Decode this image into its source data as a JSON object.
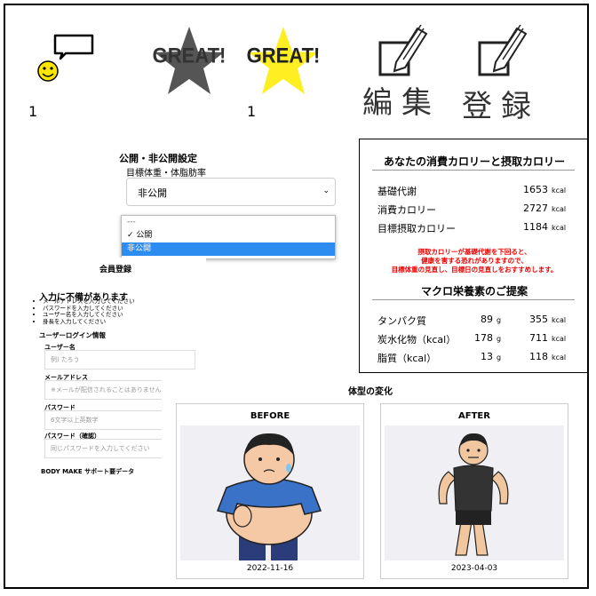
{
  "top": {
    "comment_count": "1",
    "great_label_gray": "GREAT!",
    "great_label_yellow": "GREAT!",
    "great_count": "1",
    "edit_label": "編集",
    "register_label": "登録"
  },
  "settings": {
    "title": "公開・非公開設定",
    "target_label": "目標体重・体脂肪率",
    "selected": "非公開",
    "options": [
      "---",
      "✓ 公開",
      "非公開"
    ]
  },
  "calorie": {
    "title": "あなたの消費カロリーと摂取カロリー",
    "rows": [
      {
        "label": "基礎代謝",
        "value": "1653",
        "unit": "kcal"
      },
      {
        "label": "消費カロリー",
        "value": "2727",
        "unit": "kcal"
      },
      {
        "label": "目標摂取カロリー",
        "value": "1184",
        "unit": "kcal"
      }
    ],
    "warning": [
      "摂取カロリーが基礎代謝を下回ると、",
      "健康を害する恐れがありますので、",
      "目標体重の見直し、目標日の見直しをおすすめします。"
    ],
    "macro_title": "マクロ栄養素のご提案",
    "macros": [
      {
        "label": "タンパク質",
        "grams": "89",
        "g_unit": "g",
        "kcal": "355",
        "unit": "kcal"
      },
      {
        "label": "炭水化物（kcal）",
        "grams": "178",
        "g_unit": "g",
        "kcal": "711",
        "unit": "kcal"
      },
      {
        "label": "脂質（kcal）",
        "grams": "13",
        "g_unit": "g",
        "kcal": "118",
        "unit": "kcal"
      }
    ]
  },
  "register": {
    "title": "会員登録",
    "error_title": "入力に不備があります",
    "errors": [
      "メールアドレスを入力してください",
      "パスワードを入力してください",
      "ユーザー名を入力してください",
      "身長を入力してください"
    ],
    "login_heading": "ユーザーログイン情報",
    "username_label": "ユーザー名",
    "username_placeholder": "例) たろう",
    "email_label": "メールアドレス",
    "email_placeholder": "※メールが配信されることはありません",
    "password_label": "パスワード",
    "password_placeholder": "6文字以上英数字",
    "password_confirm_label": "パスワード（確認）",
    "password_confirm_placeholder": "同じパスワードを入力してください",
    "footer_partial": "BODY MAKE サポート要データ"
  },
  "body_change": {
    "title": "体型の変化",
    "before_label": "BEFORE",
    "before_date": "2022-11-16",
    "after_label": "AFTER",
    "after_date": "2023-04-03"
  },
  "colors": {
    "star_gray": "#555555",
    "star_yellow": "#ffee22",
    "smiley": "#ffe600",
    "warning": "#ee0000",
    "dropdown_highlight": "#2d8cf0"
  }
}
